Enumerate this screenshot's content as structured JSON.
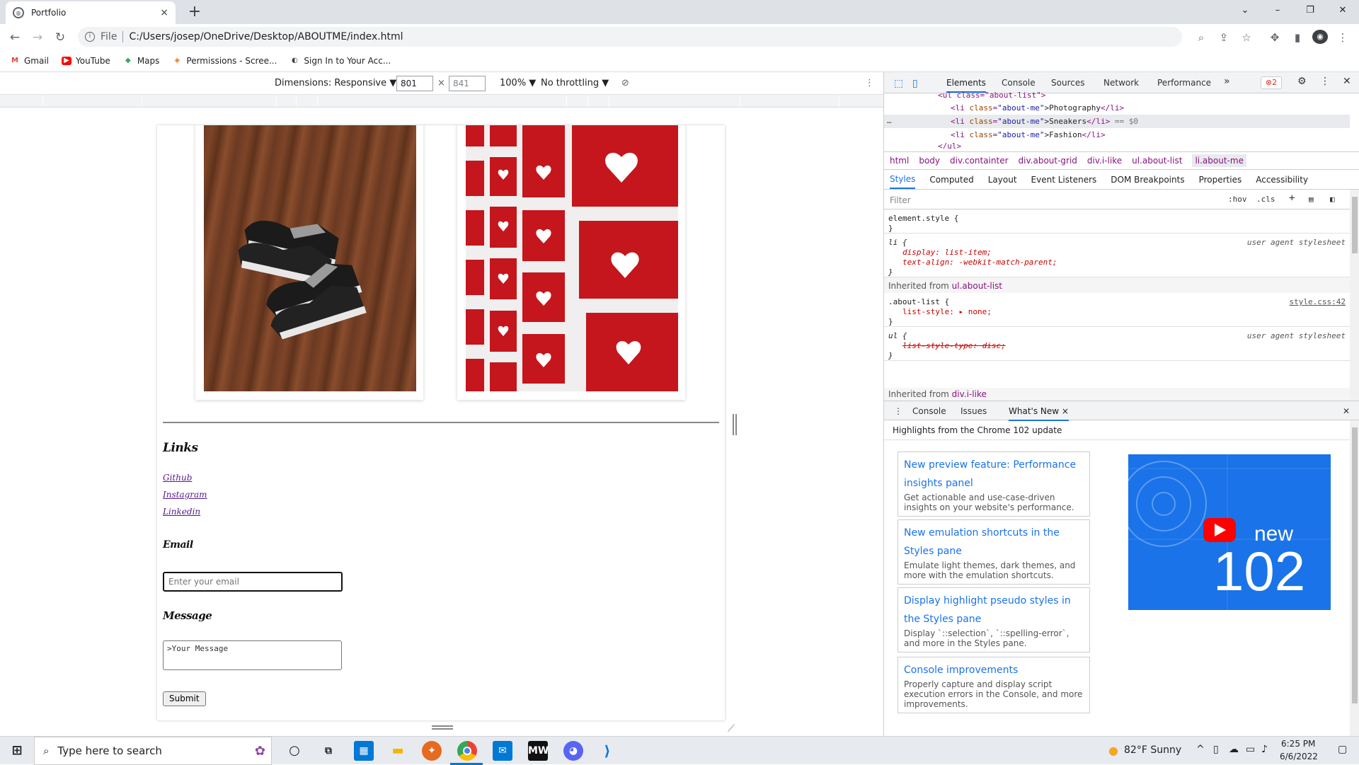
{
  "tab": {
    "title": "Portfolio",
    "close": "×",
    "new_tab": "+"
  },
  "window_controls": {
    "min": "–",
    "max": "❐",
    "close": "✕",
    "tabsearch": "⌄"
  },
  "address": {
    "scheme": "File",
    "url": "C:/Users/josep/OneDrive/Desktop/ABOUTME/index.html"
  },
  "bookmarks": [
    {
      "label": "Gmail",
      "icon": "M",
      "color": "#ea4335"
    },
    {
      "label": "YouTube",
      "icon": "▶",
      "color": "#ff0000"
    },
    {
      "label": "Maps",
      "icon": "◆",
      "color": "#34a853"
    },
    {
      "label": "Permissions - Scree...",
      "icon": "◈",
      "color": "#e8710a"
    },
    {
      "label": "Sign In to Your Acc...",
      "icon": "◐",
      "color": "#3c4043"
    }
  ],
  "device_toolbar": {
    "dimensions": "Dimensions: Responsive ▼",
    "width": "801",
    "times": "×",
    "height": "841",
    "zoom": "100% ▼",
    "throttling": "No throttling ▼"
  },
  "page": {
    "links_heading": "Links",
    "links": [
      "Github",
      "Instagram",
      "Linkedin"
    ],
    "email_heading": "Email",
    "email_placeholder": "Enter your email",
    "message_heading": "Message",
    "message_value": ">Your Message",
    "submit": "Submit"
  },
  "devtools": {
    "tabs": [
      "Elements",
      "Console",
      "Sources",
      "Network",
      "Performance",
      "»"
    ],
    "error_count": "⊗2",
    "dom": {
      "line0": "<ul class=\"about-list\">",
      "lines": [
        {
          "open": "<li ",
          "attr": "class",
          "val": "\"about-me\"",
          "text": ">Photography",
          "close": "</li>",
          "extra": ""
        },
        {
          "open": "<li ",
          "attr": "class",
          "val": "\"about-me\"",
          "text": ">Sneakers",
          "close": "</li>",
          "extra": " == $0"
        },
        {
          "open": "<li ",
          "attr": "class",
          "val": "\"about-me\"",
          "text": ">Fashion",
          "close": "</li>",
          "extra": ""
        }
      ],
      "line_end": "</ul>",
      "ellipsis": "…"
    },
    "breadcrumbs": [
      "html",
      "body",
      "div.containter",
      "div.about-grid",
      "div.i-like",
      "ul.about-list",
      "li.about-me"
    ],
    "style_tabs": [
      "Styles",
      "Computed",
      "Layout",
      "Event Listeners",
      "DOM Breakpoints",
      "Properties",
      "Accessibility"
    ],
    "filter_placeholder": "Filter",
    "filter_hov": ":hov",
    "filter_cls": ".cls",
    "filter_plus": "+",
    "rules": {
      "element_style_open": "element.style {",
      "brace_close": "}",
      "li_open": "li {",
      "li_src": "user agent stylesheet",
      "li_p1": "display: list-item;",
      "li_p2": "text-align: -webkit-match-parent;",
      "inh1_label": "Inherited from ",
      "inh1_tag": "ul.about-list",
      "about_open": ".about-list {",
      "about_src": "style.css:42",
      "about_p1": "list-style: ▸ none;",
      "ul_open": "ul {",
      "ul_src": "user agent stylesheet",
      "ul_p1": "list-style-type: disc;",
      "inh2_label": "Inherited from ",
      "inh2_tag": "div.i-like"
    },
    "drawer_tabs": [
      "Console",
      "Issues",
      "What's New"
    ],
    "drawer_close_tab": "×",
    "whats_new_heading": "Highlights from the Chrome 102 update",
    "whats_new": [
      {
        "title": "New preview feature: Performance insights panel",
        "desc": "Get actionable and use-case-driven insights on your website's performance."
      },
      {
        "title": "New emulation shortcuts in the Styles pane",
        "desc": "Emulate light themes, dark themes, and more with the emulation shortcuts."
      },
      {
        "title": "Display highlight pseudo styles in the Styles pane",
        "desc": "Display `::selection`, `::spelling-error`, and more in the Styles pane."
      },
      {
        "title": "Console improvements",
        "desc": "Properly capture and display script execution errors in the Console, and more improvements."
      }
    ],
    "banner_new": "new",
    "banner_version": "102"
  },
  "taskbar": {
    "search_placeholder": "Type here to search",
    "weather": "82°F  Sunny",
    "time": "6:25 PM",
    "date": "6/6/2022"
  },
  "colors": {
    "accent": "#1a73e8",
    "chrome_red": "#e8453c",
    "vscode_blue": "#0078d4"
  }
}
